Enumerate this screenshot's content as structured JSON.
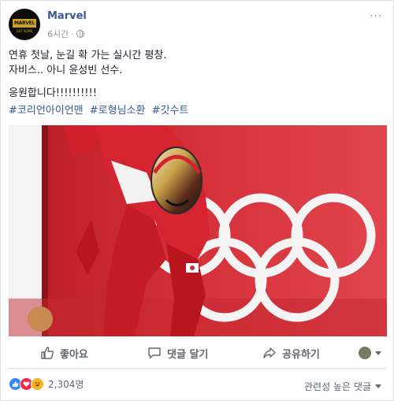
{
  "post": {
    "author": "Marvel",
    "avatar_text": "MARVEL",
    "avatar_subtext": "GET SOME",
    "time": "6시간",
    "separator": "·",
    "privacy_icon": "globe-icon",
    "options_label": "···",
    "text_lines": [
      "연휴 첫날, 눈길 확 가는 실시간 평창.",
      "자비스.. 아니 윤성빈 선수."
    ],
    "cheer": "응원합니다!!!!!!!!!!",
    "hashtags": [
      "#코리언아이언맨",
      "#로형님소환",
      "#갓수트"
    ]
  },
  "actions": {
    "like_label": "좋아요",
    "comment_label": "댓글 달기",
    "share_label": "공유하기"
  },
  "reactions": {
    "icons": [
      "like-reaction-icon",
      "love-reaction-icon",
      "haha-reaction-icon"
    ],
    "count": "2,304명"
  },
  "comments": {
    "sort_label": "관련성 높은 댓글"
  },
  "colors": {
    "link": "#365899",
    "photo_background": "#d42a33",
    "olympic_rings": "#f4f4f4"
  }
}
